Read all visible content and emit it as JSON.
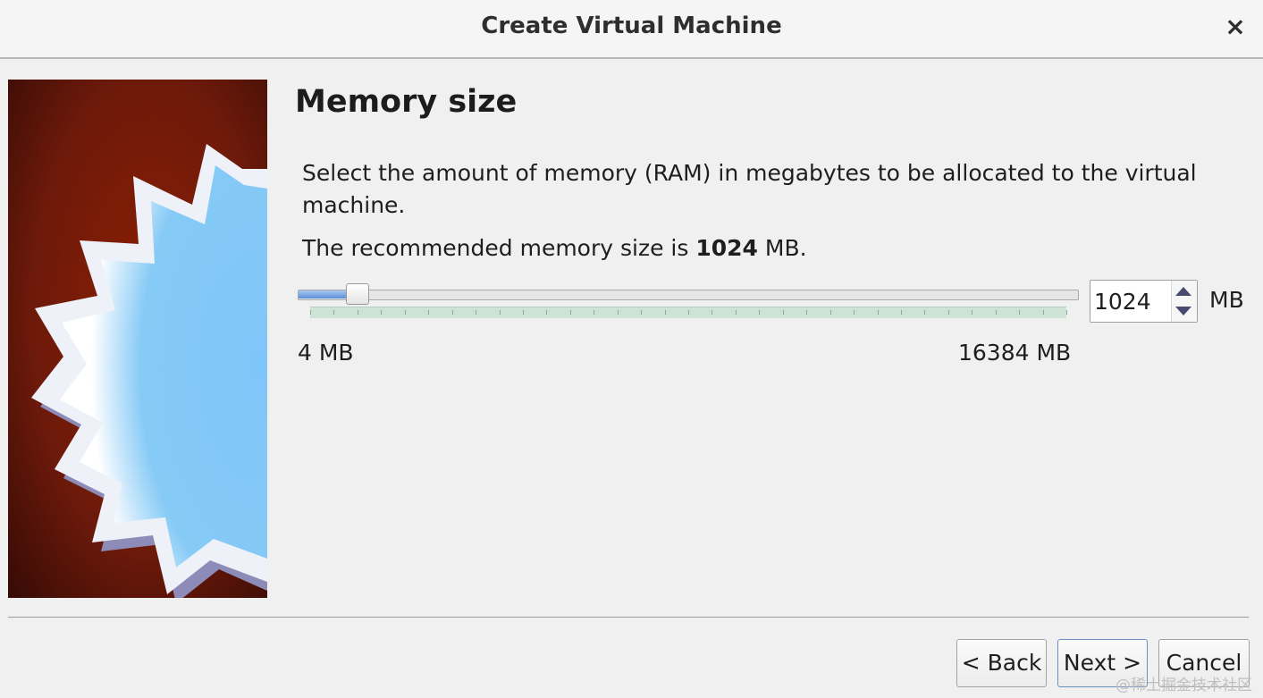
{
  "window": {
    "title": "Create Virtual Machine",
    "close_icon": "×"
  },
  "page": {
    "heading": "Memory size",
    "description": "Select the amount of memory (RAM) in megabytes to be allocated to the virtual machine.",
    "recommend_prefix": "The recommended memory size is ",
    "recommend_value": "1024",
    "recommend_suffix": " MB."
  },
  "memory": {
    "slider_min_label": "4 MB",
    "slider_max_label": "16384 MB",
    "slider_min": 4,
    "slider_max": 16384,
    "slider_value": 1024,
    "input_value": "1024",
    "unit": "MB"
  },
  "buttons": {
    "back": "< Back",
    "next": "Next >",
    "cancel": "Cancel"
  },
  "watermark": "@稀土掘金技术社区",
  "colors": {
    "banner_background": "#6e1a0a",
    "banner_star": "#7fc6f8",
    "slider_fill": "#5b8fd6"
  }
}
